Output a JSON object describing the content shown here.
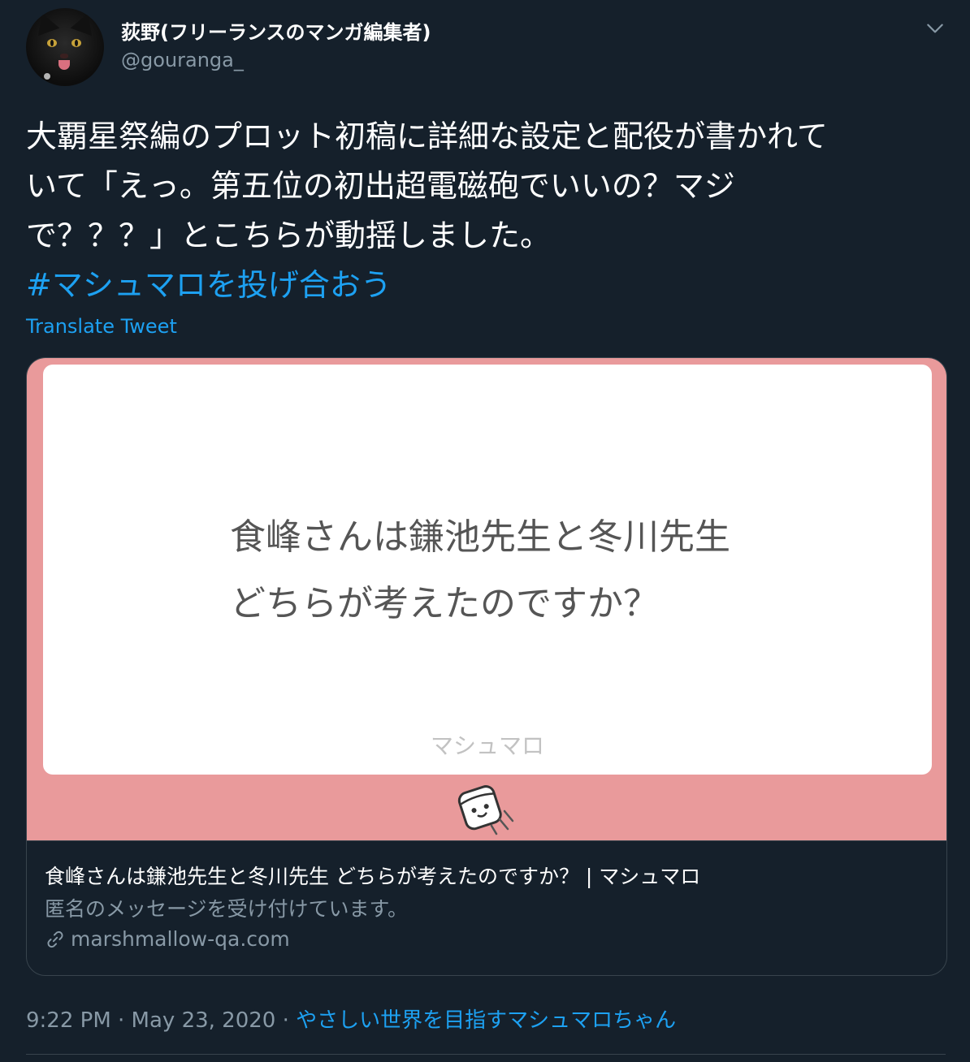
{
  "author": {
    "display_name": "荻野(フリーランスのマンガ編集者)",
    "handle": "@gouranga_"
  },
  "tweet": {
    "lines": [
      "大覇星祭編のプロット初稿に詳細な設定と配役が書かれて",
      "いて「えっ。第五位の初出超電磁砲でいいの？マジ",
      "で？？？」とこちらが動揺しました。"
    ],
    "hashtag": "#マシュマロを投げ合おう",
    "translate_label": "Translate Tweet"
  },
  "card": {
    "question_lines": [
      "食峰さんは鎌池先生と冬川先生",
      "どちらが考えたのですか？"
    ],
    "brand": "マシュマロ",
    "title": "食峰さんは鎌池先生と冬川先生 どちらが考えたのですか？ | マシュマロ",
    "description": "匿名のメッセージを受け付けています。",
    "domain": "marshmallow-qa.com"
  },
  "meta": {
    "timestamp": "9:22 PM · May 23, 2020 · ",
    "source": "やさしい世界を目指すマシュマロちゃん"
  },
  "colors": {
    "background": "#15202b",
    "accent": "#1da1f2",
    "secondary_text": "#8899a6",
    "card_pink": "#e99a9b"
  }
}
